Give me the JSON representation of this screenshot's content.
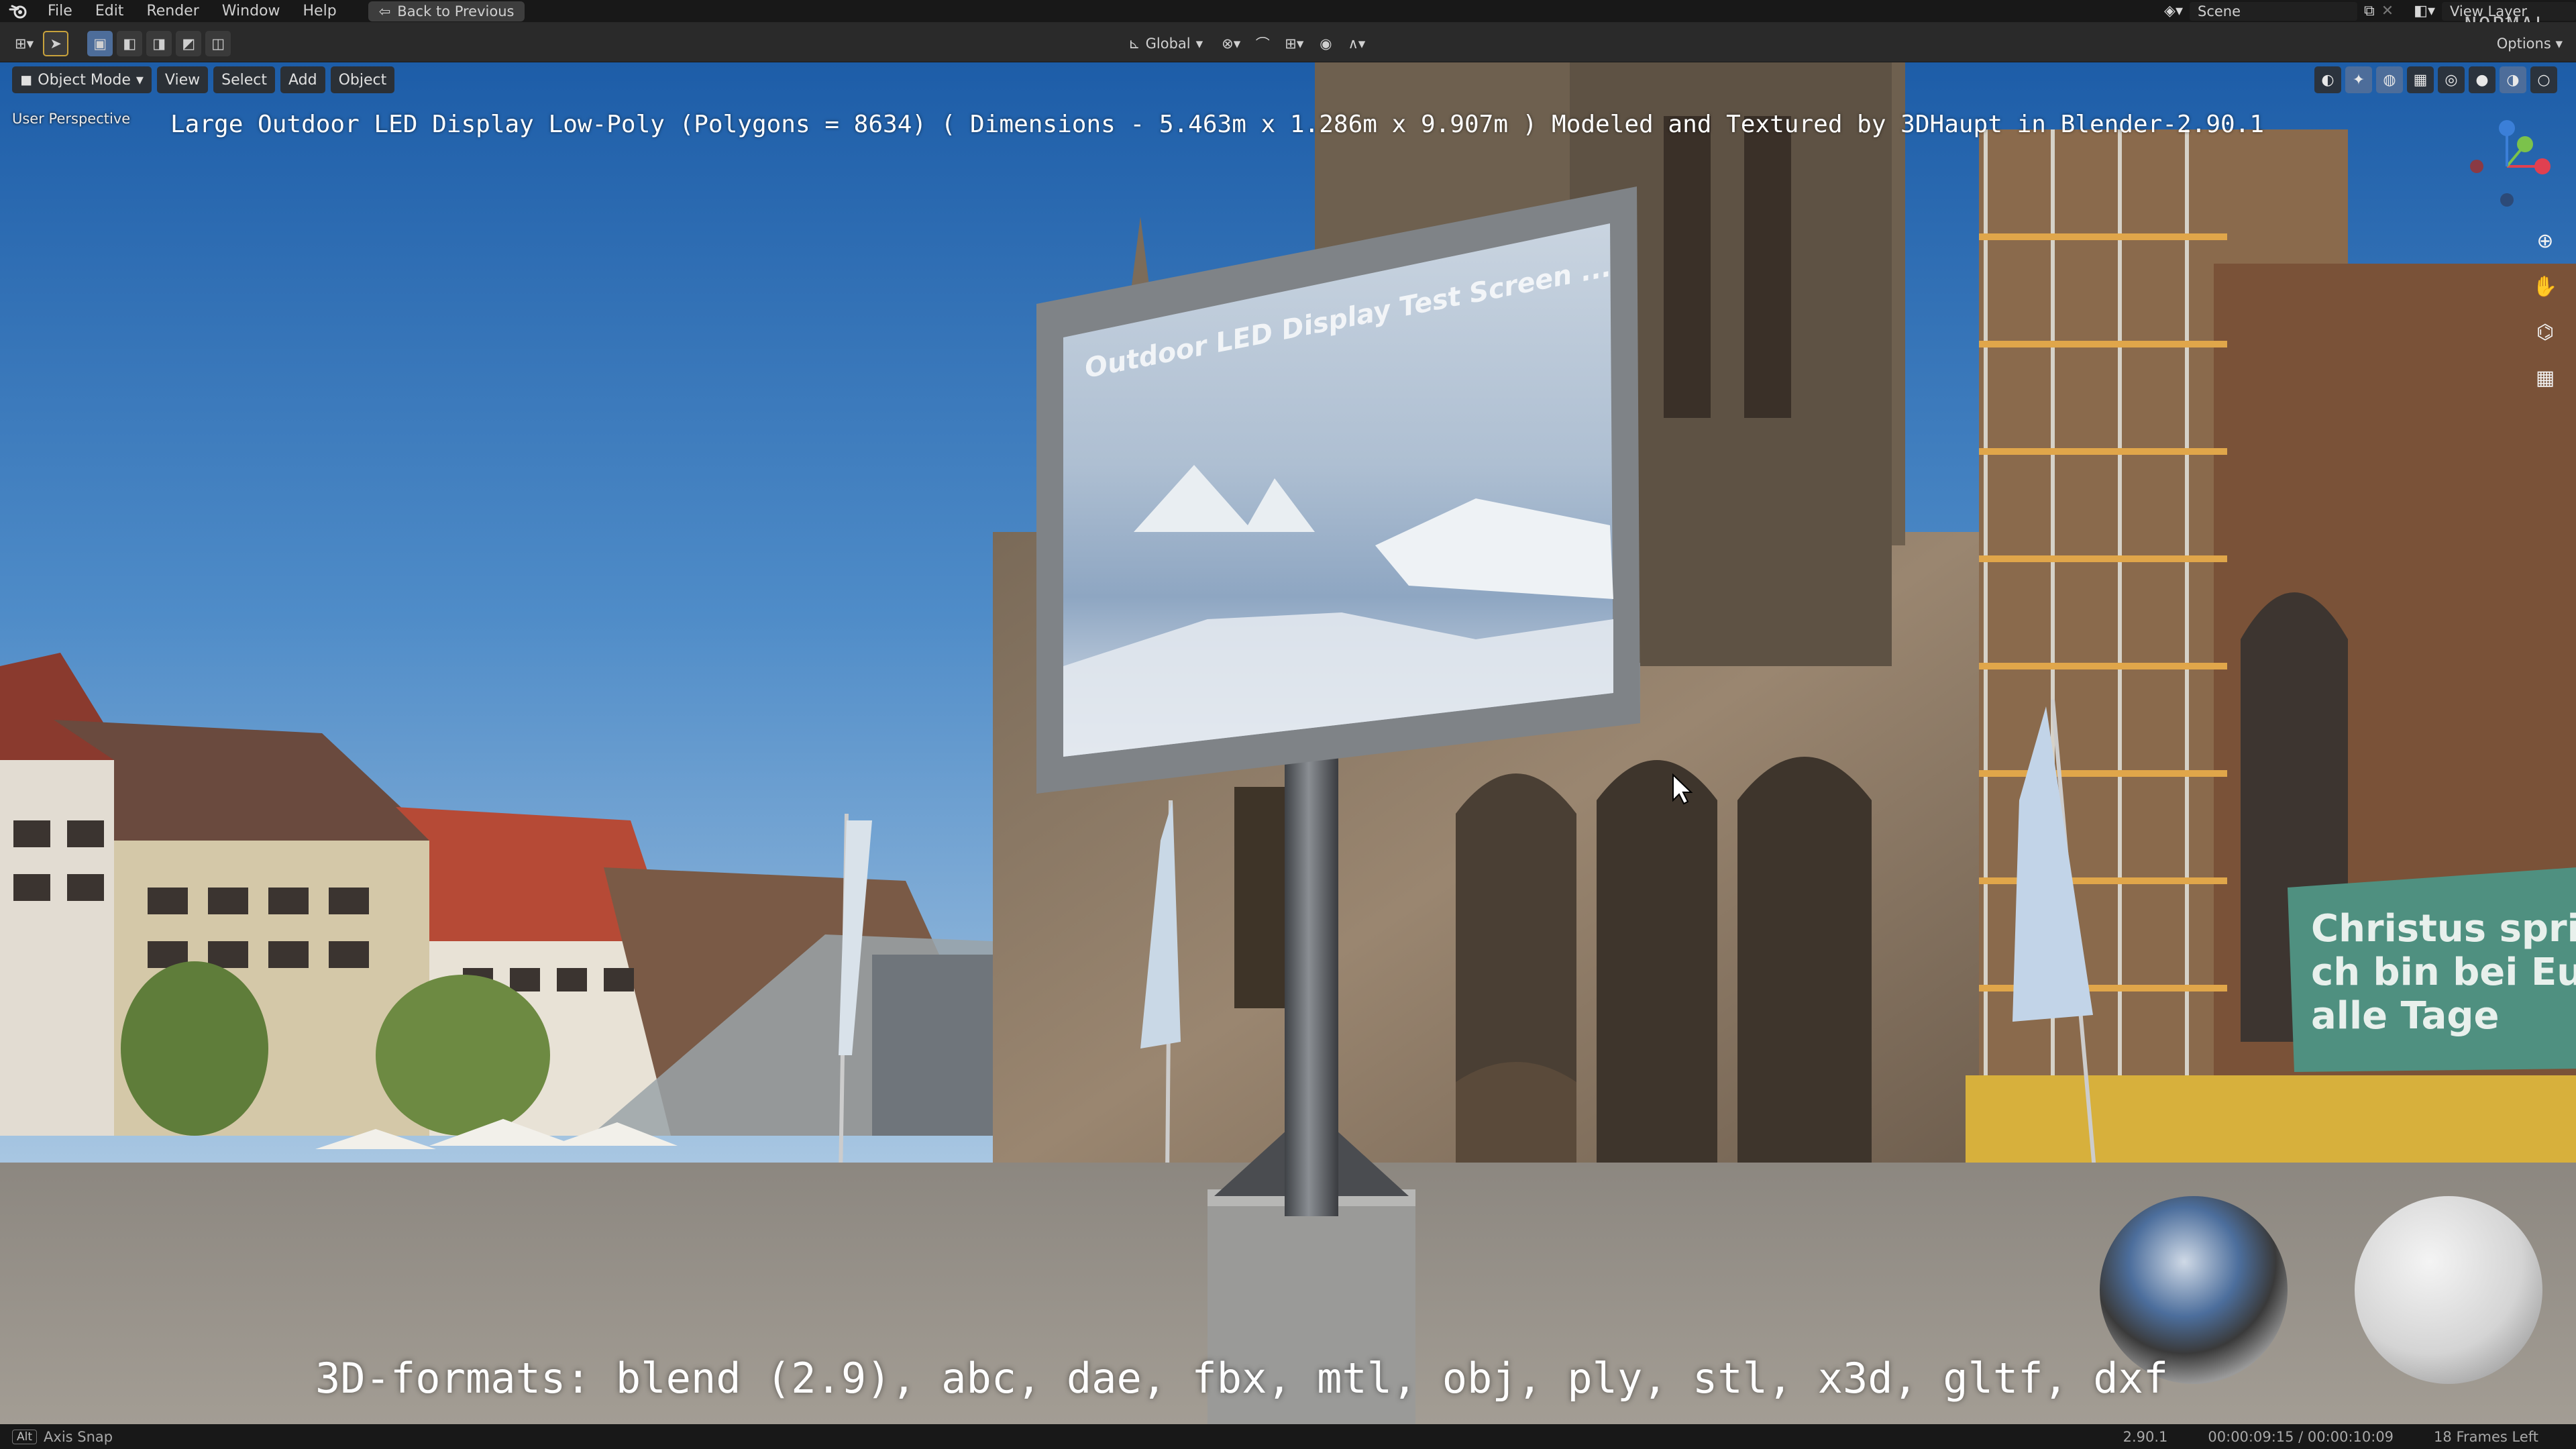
{
  "menu": {
    "items": [
      "File",
      "Edit",
      "Render",
      "Window",
      "Help"
    ],
    "back_button": "Back to Previous",
    "scene_label": "Scene",
    "view_layer_label": "View Layer",
    "watermark": "NORMAL"
  },
  "toolbar": {
    "orientation": "Global",
    "options_label": "Options"
  },
  "viewport": {
    "mode": "Object Mode",
    "menus": [
      "View",
      "Select",
      "Add",
      "Object"
    ],
    "perspective_label": "User Perspective",
    "overlay_title": "Large Outdoor LED Display Low-Poly (Polygons = 8634) ( Dimensions -  5.463m x 1.286m x 9.907m ) Modeled and Textured by 3DHaupt in Blender-2.90.1",
    "formats_text": "3D-formats: blend (2.9), abc, dae, fbx, mtl, obj, ply, stl, x3d, gltf, dxf",
    "screen_text": "Outdoor LED Display Test Screen ...",
    "banner_lines": [
      "Christus spric",
      "ch bin bei Euc",
      "alle Tage"
    ],
    "gizmo_axes": [
      "X",
      "Y",
      "Z"
    ]
  },
  "statusbar": {
    "key": "Alt",
    "hint": "Axis Snap",
    "version": "2.90.1",
    "timecode": "00:00:09:15 / 00:00:10:09",
    "frames_left": "18 Frames Left"
  },
  "icons": [
    "blender-logo-icon",
    "editor-type-icon",
    "select-box-icon",
    "cursor-icon",
    "transform-orientation-icon",
    "pivot-icon",
    "snap-icon",
    "proportional-icon",
    "zoom-icon",
    "hand-icon",
    "camera-icon",
    "grid-icon"
  ],
  "colors": {
    "header_bg": "#2a2a2a",
    "topbar_bg": "#181818",
    "accent": "#4d6d9a",
    "sky_top": "#1d5da8"
  }
}
